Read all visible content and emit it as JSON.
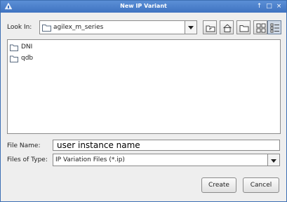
{
  "window": {
    "title": "New IP Variant"
  },
  "look_in": {
    "label": "Look In:",
    "value": "agilex_m_series"
  },
  "toolbar": {
    "buttons": [
      "up-one-level-icon",
      "home-icon",
      "new-folder-icon",
      "list-view-icon",
      "details-view-icon"
    ]
  },
  "files": [
    {
      "name": "DNI",
      "type": "folder"
    },
    {
      "name": "qdb",
      "type": "folder"
    }
  ],
  "file_name": {
    "label": "File Name:",
    "value": "user instance name"
  },
  "file_type": {
    "label": "Files of Type:",
    "value": "IP Variation Files (*.ip)"
  },
  "buttons": {
    "create": "Create",
    "cancel": "Cancel"
  },
  "colors": {
    "titlebar": "#4a7fcc",
    "accent": "#3d6fb4"
  }
}
